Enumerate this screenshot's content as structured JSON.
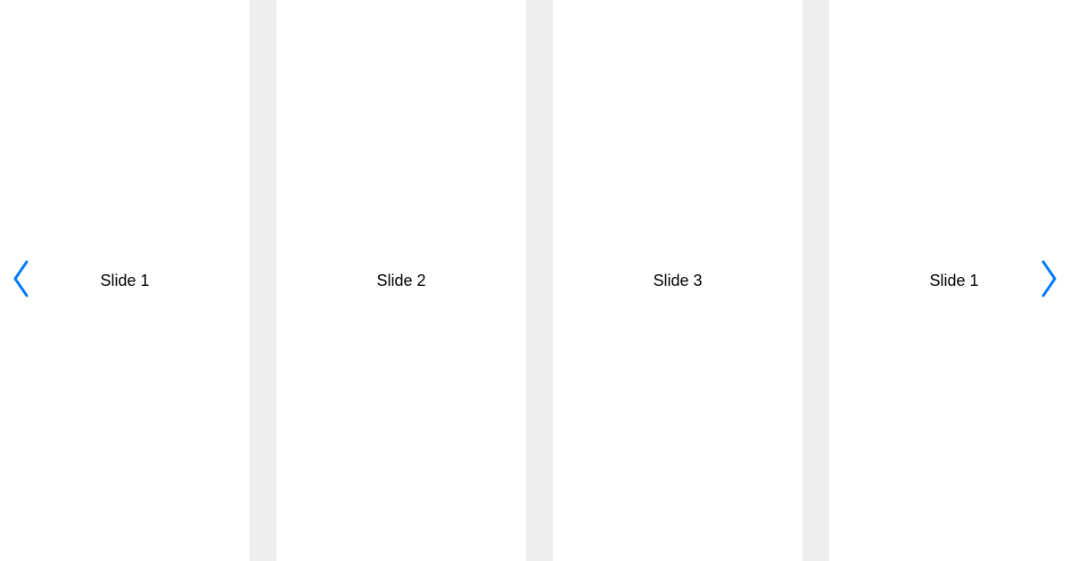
{
  "carousel": {
    "slides": [
      {
        "label": "Slide 1"
      },
      {
        "label": "Slide 2"
      },
      {
        "label": "Slide 3"
      },
      {
        "label": "Slide 1"
      }
    ],
    "accent_color": "#007aff"
  }
}
